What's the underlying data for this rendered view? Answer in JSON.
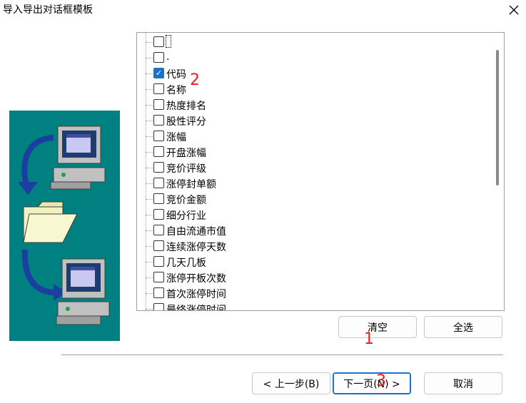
{
  "window": {
    "title": "导入导出对话框模板",
    "close_icon": "close-icon"
  },
  "field_list": {
    "items": [
      {
        "label": "",
        "checked": false,
        "focused": true
      },
      {
        "label": ".",
        "checked": false
      },
      {
        "label": "代码",
        "checked": true
      },
      {
        "label": "名称",
        "checked": false
      },
      {
        "label": "热度排名",
        "checked": false
      },
      {
        "label": "股性评分",
        "checked": false
      },
      {
        "label": "涨幅",
        "checked": false
      },
      {
        "label": "开盘涨幅",
        "checked": false
      },
      {
        "label": "竞价评级",
        "checked": false
      },
      {
        "label": "涨停封单额",
        "checked": false
      },
      {
        "label": "竞价金额",
        "checked": false
      },
      {
        "label": "细分行业",
        "checked": false
      },
      {
        "label": "自由流通市值",
        "checked": false
      },
      {
        "label": "连续涨停天数",
        "checked": false
      },
      {
        "label": "几天几板",
        "checked": false
      },
      {
        "label": "涨停开板次数",
        "checked": false
      },
      {
        "label": "首次涨停时间",
        "checked": false
      },
      {
        "label": "最终涨停时间",
        "checked": false
      }
    ]
  },
  "buttons": {
    "clear": "清空",
    "select_all": "全选",
    "back": "< 上一步(B)",
    "next": "下一页(N) >",
    "cancel": "取消"
  },
  "annotations": {
    "a1": "1",
    "a2": "2",
    "a3": "3"
  },
  "colors": {
    "wizard_bg": "#008080",
    "accent": "#1a73c9",
    "annotation": "#e02020"
  }
}
